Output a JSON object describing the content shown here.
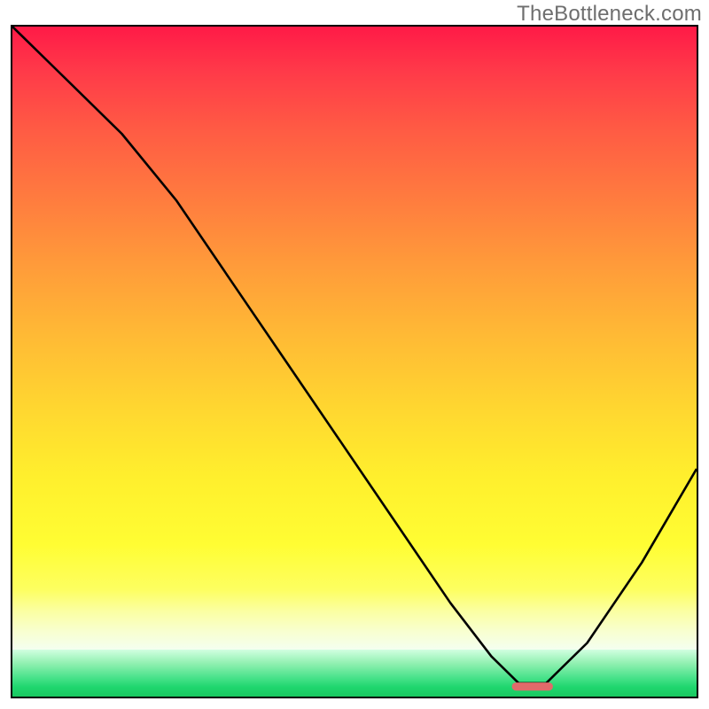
{
  "watermark": "TheBottleneck.com",
  "chart_data": {
    "type": "line",
    "title": "",
    "xlabel": "",
    "ylabel": "",
    "xlim": [
      0,
      100
    ],
    "ylim": [
      0,
      100
    ],
    "series": [
      {
        "name": "bottleneck-curve",
        "x": [
          0,
          8,
          16,
          24,
          32,
          40,
          48,
          56,
          64,
          70,
          74,
          78,
          84,
          92,
          100
        ],
        "y": [
          100,
          92,
          84,
          74,
          62,
          50,
          38,
          26,
          14,
          6,
          2,
          2,
          8,
          20,
          34
        ]
      }
    ],
    "marker": {
      "x": 76,
      "y": 1.5,
      "width": 6,
      "height": 1.2
    },
    "gradient_bands": [
      {
        "name": "red-orange-yellow",
        "from_y": 100,
        "to_y": 16
      },
      {
        "name": "pale-yellow",
        "from_y": 16,
        "to_y": 7
      },
      {
        "name": "green",
        "from_y": 7,
        "to_y": 0
      }
    ]
  }
}
